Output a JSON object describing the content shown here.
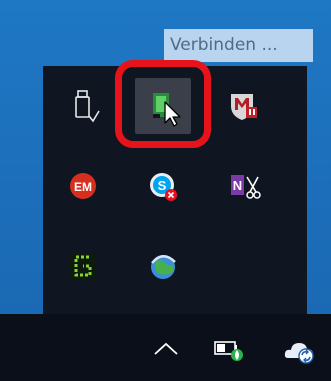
{
  "tooltip": {
    "text": "Verbinden ..."
  },
  "tray_overflow": {
    "items": [
      {
        "name": "usb-eject",
        "icon": "usb-drive-icon",
        "highlighted": false
      },
      {
        "name": "green-app",
        "icon": "green-square-app-icon",
        "highlighted": true
      },
      {
        "name": "mcafee",
        "icon": "mcafee-shield-icon",
        "highlighted": false
      },
      {
        "name": "em-client",
        "icon": "em-client-icon",
        "highlighted": false,
        "label": "EM"
      },
      {
        "name": "skype",
        "icon": "skype-icon",
        "highlighted": false
      },
      {
        "name": "onenote-clipper",
        "icon": "onenote-clipper-icon",
        "highlighted": false,
        "label": "N"
      },
      {
        "name": "greenshot",
        "icon": "greenshot-icon",
        "highlighted": false
      },
      {
        "name": "network-globe",
        "icon": "globe-icon",
        "highlighted": false
      }
    ]
  },
  "highlight_color": "#e7131b",
  "taskbar": {
    "icons": [
      "show-hidden-icons-chevron-icon",
      "battery-icon",
      "cloud-sync-icon"
    ]
  }
}
